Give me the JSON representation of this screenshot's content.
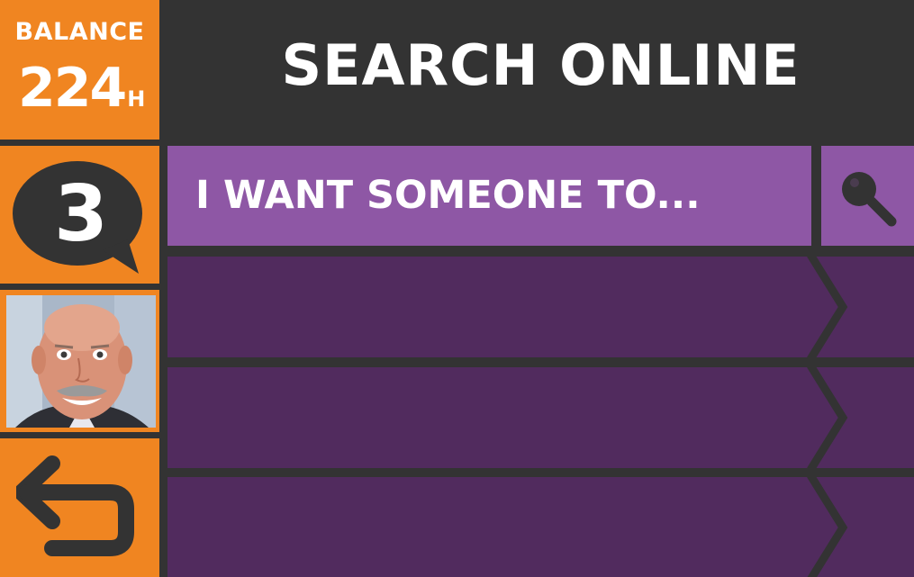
{
  "sidebar": {
    "balance": {
      "label": "BALANCE",
      "value": "224",
      "unit": "H"
    },
    "notifications": {
      "count": "3",
      "icon": "speech-bubble-icon"
    },
    "avatar": {
      "icon": "user-photo"
    },
    "back": {
      "icon": "back-arrow-icon"
    }
  },
  "header": {
    "title": "SEARCH ONLINE"
  },
  "search": {
    "text": "I WANT SOMEONE TO...",
    "icon": "search-icon"
  },
  "results": [
    {
      "label": ""
    },
    {
      "label": ""
    },
    {
      "label": ""
    }
  ],
  "colors": {
    "accent_orange": "#F08521",
    "background": "#333333",
    "search_purple": "#8E57A5",
    "row_purple": "#512B5E",
    "text": "#FFFFFF"
  }
}
